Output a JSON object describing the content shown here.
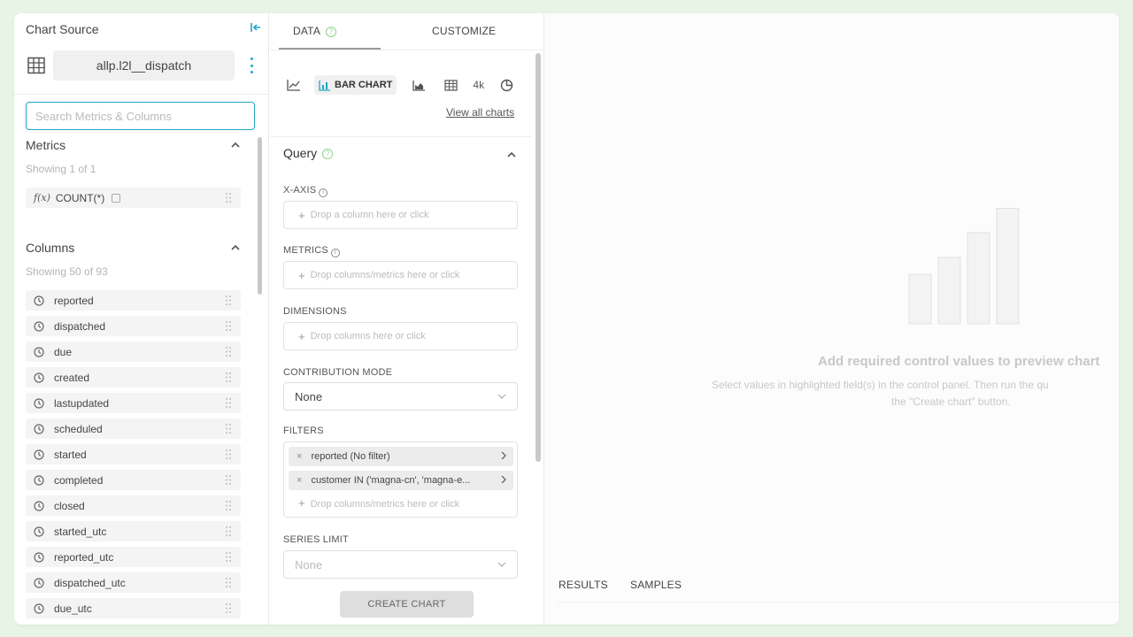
{
  "left_panel": {
    "title": "Chart Source",
    "dataset": "allp.l2l__dispatch",
    "search_placeholder": "Search Metrics & Columns",
    "metrics": {
      "title": "Metrics",
      "showing": "Showing 1 of 1",
      "items": [
        "COUNT(*)"
      ]
    },
    "columns": {
      "title": "Columns",
      "showing": "Showing 50 of 93",
      "items": [
        "reported",
        "dispatched",
        "due",
        "created",
        "lastupdated",
        "scheduled",
        "started",
        "completed",
        "closed",
        "started_utc",
        "reported_utc",
        "dispatched_utc",
        "due_utc"
      ]
    }
  },
  "middle_panel": {
    "tabs": [
      "DATA",
      "CUSTOMIZE"
    ],
    "viz": {
      "active_label": "BAR CHART",
      "big_number_label": "4k",
      "view_all": "View all charts"
    },
    "query_title": "Query",
    "x_axis": {
      "label": "X-AXIS",
      "placeholder": "Drop a column here or click"
    },
    "metrics": {
      "label": "METRICS",
      "placeholder": "Drop columns/metrics here or click"
    },
    "dimensions": {
      "label": "DIMENSIONS",
      "placeholder": "Drop columns here or click"
    },
    "contribution": {
      "label": "CONTRIBUTION MODE",
      "value": "None"
    },
    "filters": {
      "label": "FILTERS",
      "items": [
        "reported (No filter)",
        "customer IN ('magna-cn', 'magna-e..."
      ],
      "placeholder": "Drop columns/metrics here or click"
    },
    "series_limit": {
      "label": "SERIES LIMIT",
      "value": "None"
    },
    "create_button": "CREATE CHART"
  },
  "right_panel": {
    "empty_title": "Add required control values to preview chart",
    "empty_desc_line1": "Select values in highlighted field(s) in the control panel. Then run the qu",
    "empty_desc_line2": "the \"Create chart\" button.",
    "tabs": [
      "RESULTS",
      "SAMPLES"
    ]
  },
  "colors": {
    "accent": "#20a7c9",
    "background": "#e7f4e6",
    "help_green": "#8ed18e"
  }
}
